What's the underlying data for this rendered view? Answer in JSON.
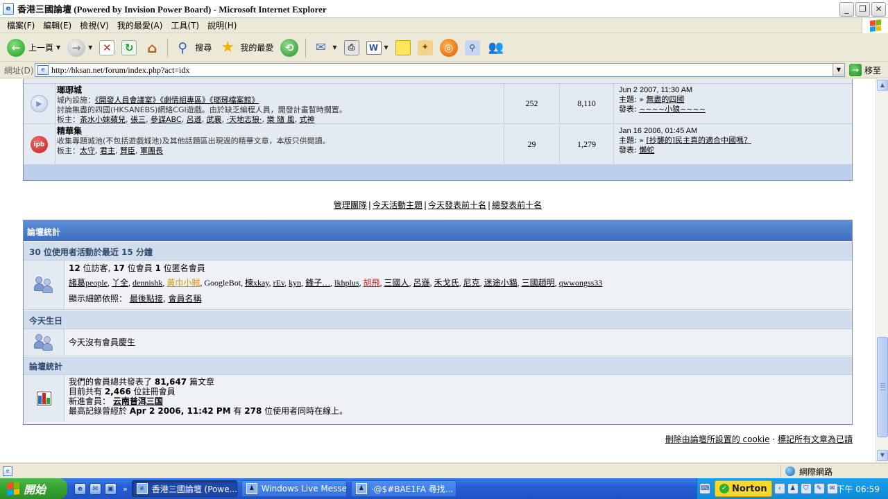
{
  "window": {
    "title": "香港三國論壇 (Powered by Invision Power Board) - Microsoft Internet Explorer",
    "buttons": [
      "_",
      "❐",
      "✕"
    ]
  },
  "menu": {
    "items": [
      "檔案(F)",
      "編輯(E)",
      "檢視(V)",
      "我的最愛(A)",
      "工具(T)",
      "說明(H)"
    ]
  },
  "toolbar": {
    "back_label": "上一頁",
    "search_label": "搜尋",
    "favorites_label": "我的最愛"
  },
  "address": {
    "label": "網址(D)",
    "url": "http://hksan.net/forum/index.php?act=idx",
    "go_label": "移至"
  },
  "forums": [
    {
      "name": "瑯琊城",
      "desc_prefix": "城內設施：",
      "desc_links": [
        "《開發人員會議室》",
        "《劇情組專區》",
        "《瑯琊檔案館》"
      ],
      "desc2": "討論無盡的四國(HKSANEBS)網絡CGI遊戲。由於缺乏編程人員，開發計畫暫時擱置。",
      "mods_label": "板主：",
      "mods": [
        "茶水小妹蘋兒",
        "張三",
        "參謀ABC",
        "呂遜",
        "武襄",
        "‧天地志狼‧",
        "樂 隨 風",
        "式神"
      ],
      "topics": "252",
      "replies": "8,110",
      "last_date": "Jun 2 2007, 11:30 AM",
      "last_topic_label": "主題: »",
      "last_topic": "無盡的四國",
      "last_poster_label": "發表:",
      "last_poster": "~~~~小狼~~~~"
    },
    {
      "name": "精華集",
      "desc_prefix": "收集專題城池(不包括遊戲城池)及其他話題區出現過的精華文章，本版只供閱讀。",
      "desc_links": [],
      "desc2": "",
      "mods_label": "板主：",
      "mods": [
        "太守",
        "君主",
        "賢臣",
        "軍團長"
      ],
      "topics": "29",
      "replies": "1,279",
      "last_date": "Jan 16 2006, 01:45 AM",
      "last_topic_label": "主題: »",
      "last_topic": "[抄襲的]民主真的適合中國嗎？",
      "last_poster_label": "發表:",
      "last_poster": "懶蛇"
    }
  ],
  "links": [
    "管理團隊",
    "今天活動主題",
    "今天發表前十名",
    "總發表前十名"
  ],
  "stats": {
    "title": "論壇統計",
    "active_header": "30 位使用者活動於最近 15 分鐘",
    "active_summary": {
      "guests": "12",
      "guests_label": "位訪客,",
      "members": "17",
      "members_label": "位會員",
      "anon": "1",
      "anon_label": "位匿名會員"
    },
    "online_users": [
      {
        "name": "諸葛people",
        "style": "normal"
      },
      {
        "name": "丫全",
        "style": "normal"
      },
      {
        "name": "dennishk",
        "style": "normal"
      },
      {
        "name": "黃巾小賊",
        "style": "gold"
      },
      {
        "name": "GoogleBot",
        "style": "plain"
      },
      {
        "name": "楝xkay",
        "style": "normal"
      },
      {
        "name": "rEv",
        "style": "normal"
      },
      {
        "name": "kyn",
        "style": "normal"
      },
      {
        "name": "鋒子…",
        "style": "normal"
      },
      {
        "name": "lkhplus",
        "style": "normal"
      },
      {
        "name": "胡飛",
        "style": "red"
      },
      {
        "name": "三國人",
        "style": "normal"
      },
      {
        "name": "呂遜",
        "style": "normal"
      },
      {
        "name": "禾戈氏",
        "style": "normal"
      },
      {
        "name": "尼克",
        "style": "normal"
      },
      {
        "name": "迷途小貓",
        "style": "normal"
      },
      {
        "name": "三國趙明",
        "style": "normal"
      },
      {
        "name": "qwwongss33",
        "style": "normal"
      }
    ],
    "sort_label": "顯示細節依照：",
    "sort_links": [
      "最後點接",
      "會員名稱"
    ],
    "birthday_header": "今天生日",
    "birthday_text": "今天沒有會員慶生",
    "board_header": "論壇統計",
    "posts_prefix": "我們的會員總共發表了",
    "posts_count": "81,647",
    "posts_suffix": "篇文章",
    "members_prefix": "目前共有",
    "members_count": "2,466",
    "members_suffix": "位註冊會員",
    "newest_label": "新進會員：",
    "newest_member": "云南普洱三国",
    "record_prefix": "最高記錄曾經於",
    "record_date": "Apr 2 2006, 11:42 PM",
    "record_mid": "有",
    "record_count": "278",
    "record_suffix": "位使用者同時在線上。"
  },
  "footer": {
    "delete_cookies": "刪除由論壇所設置的 cookie",
    "dot": "·",
    "mark_read": "標記所有文章為已讀"
  },
  "statusbar": {
    "zone": "網際網路"
  },
  "taskbar": {
    "start_label": "開始",
    "quick_more": "»",
    "tasks": [
      {
        "label": "香港三國論壇 (Powe...",
        "active": true
      },
      {
        "label": "Windows Live Messen...",
        "active": false
      },
      {
        "label": "·@$#BAE1FA 尋找...",
        "active": false
      }
    ],
    "norton": "Norton",
    "clock": "下午 06:59"
  },
  "colors": {
    "stats_header": "#4a7dcc",
    "subheader": "#d1dced",
    "row_bg": "#eef2f7",
    "online_gold": "#d89a00",
    "online_red": "#d01c1c"
  }
}
